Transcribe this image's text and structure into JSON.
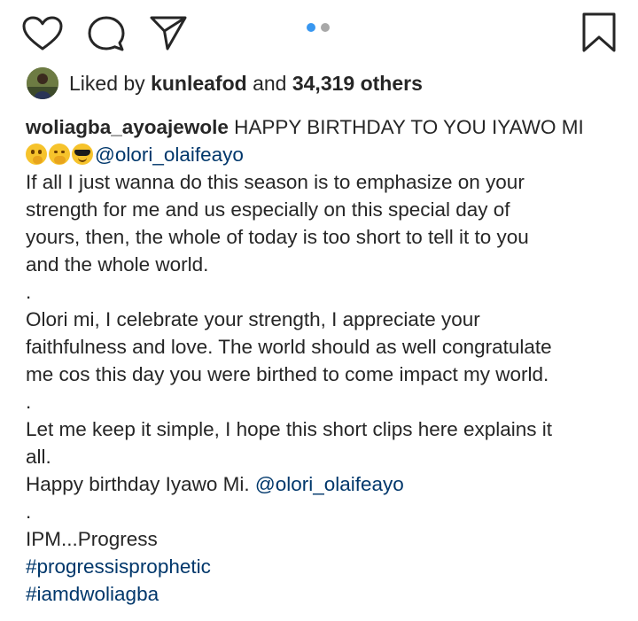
{
  "actions": {
    "like_icon": "heart-icon",
    "comment_icon": "comment-icon",
    "share_icon": "send-icon",
    "save_icon": "bookmark-icon"
  },
  "carousel": {
    "count": 2,
    "active_index": 0,
    "active_color": "#3897f0",
    "inactive_color": "#a8a8a8"
  },
  "likes": {
    "prefix": "Liked by",
    "user": "kunleafod",
    "middle": "and",
    "count_text": "34,319 others"
  },
  "caption": {
    "username": "woliagba_ayoajewole",
    "first_line_text": "HAPPY BIRTHDAY TO YOU IYAWO MI",
    "emojis": [
      "shushing-face",
      "hand-over-mouth-face",
      "sunglasses-face"
    ],
    "mention_1": "@olori_olaifeayo",
    "l3": "If all I just wanna do this season is to emphasize on your",
    "l4": "strength for me and us especially on this special day of",
    "l5": "yours, then, the whole of today is too short to tell it to you",
    "l6": "and the whole world.",
    "sep1": ".",
    "l8": "Olori mi, I celebrate your strength, I appreciate your",
    "l9": "faithfulness and love. The world should as well congratulate",
    "l10": "me cos this day you were birthed to come impact my world.",
    "sep2": ".",
    "l12": "Let me keep it simple, I hope this short clips here explains it",
    "l13": "all.",
    "l14_prefix": "Happy birthday Iyawo Mi.",
    "mention_2": "@olori_olaifeayo",
    "sep3": ".",
    "l16": "IPM...Progress",
    "hashtag_1": "#progressisprophetic",
    "hashtag_2": "#iamdwoliagba"
  },
  "colors": {
    "text": "#262626",
    "link": "#00376b",
    "muted": "#8e8e8e"
  }
}
